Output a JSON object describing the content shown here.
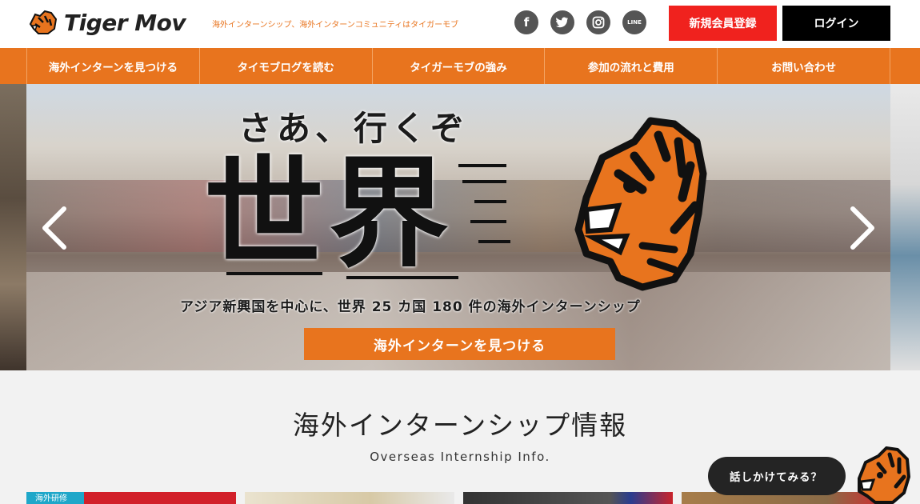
{
  "header": {
    "logo_text": "Tiger Mov",
    "tagline": "海外インターンシップ、海外インターンコミュニティはタイガーモブ",
    "social": [
      {
        "name": "facebook",
        "glyph": "f"
      },
      {
        "name": "twitter",
        "glyph": "🐦"
      },
      {
        "name": "instagram",
        "glyph": "◎"
      },
      {
        "name": "line",
        "glyph": "LINE"
      }
    ],
    "register_label": "新規会員登録",
    "login_label": "ログイン"
  },
  "nav": {
    "items": [
      {
        "label": "海外インターンを見つける"
      },
      {
        "label": "タイモブログを読む"
      },
      {
        "label": "タイガーモブの強み"
      },
      {
        "label": "参加の流れと費用"
      },
      {
        "label": "お問い合わせ"
      }
    ]
  },
  "hero": {
    "subtitle": "さあ、行くぞ",
    "headline": "世界",
    "caption": "アジア新興国を中心に、世界 25 カ国 180 件の海外インターンシップ",
    "cta_label": "海外インターンを見つける"
  },
  "section": {
    "title": "海外インターンシップ情報",
    "subtitle": "Overseas Internship Info."
  },
  "cards": [
    {
      "tag": "海外研修"
    },
    {
      "tag": ""
    },
    {
      "tag": ""
    },
    {
      "tag": ""
    }
  ],
  "chat": {
    "label": "話しかけてみる？"
  },
  "colors": {
    "accent": "#e8741e",
    "register": "#f0221e",
    "login": "#000000",
    "tag": "#1fa7c9"
  }
}
